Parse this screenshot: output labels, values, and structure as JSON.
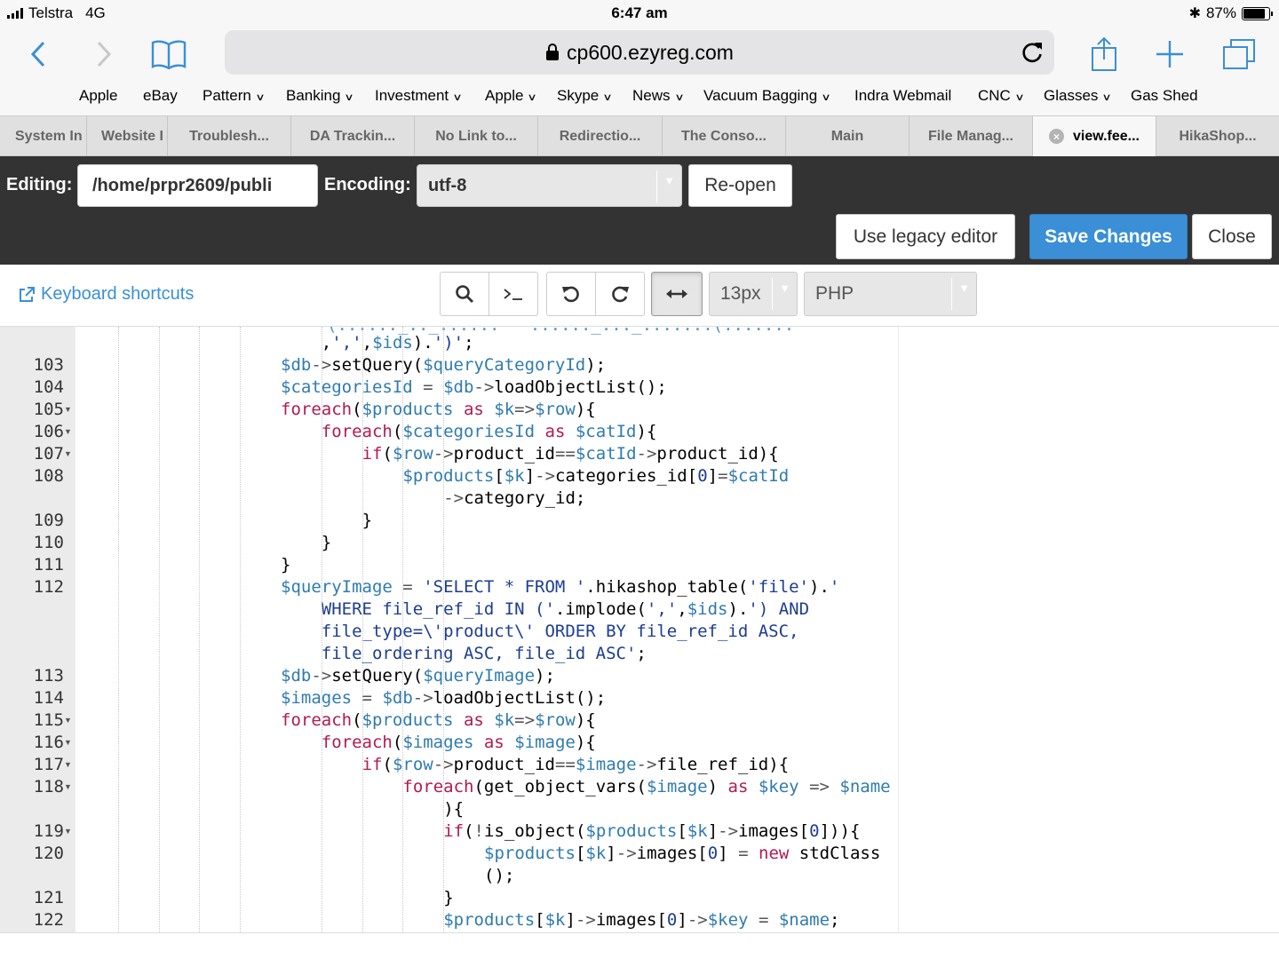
{
  "status_bar": {
    "carrier": "Telstra",
    "network": "4G",
    "time": "6:47 am",
    "battery": "87%",
    "battery_level": 0.87
  },
  "browser": {
    "url": "cp600.ezyreg.com",
    "icons": [
      "back-icon",
      "forward-icon",
      "bookmarks-book-icon",
      "lock-icon",
      "reload-icon",
      "share-icon",
      "new-tab-plus-icon",
      "tabs-overview-icon"
    ],
    "bookmarks": [
      {
        "label": "Apple",
        "dropdown": false
      },
      {
        "label": "eBay",
        "dropdown": false
      },
      {
        "label": "Pattern",
        "dropdown": true
      },
      {
        "label": "Banking",
        "dropdown": true
      },
      {
        "label": "Investment",
        "dropdown": true
      },
      {
        "label": "Apple",
        "dropdown": true
      },
      {
        "label": "Skype",
        "dropdown": true
      },
      {
        "label": "News",
        "dropdown": true
      },
      {
        "label": "Vacuum Bagging",
        "dropdown": true
      },
      {
        "label": "Indra Webmail",
        "dropdown": false
      },
      {
        "label": "CNC",
        "dropdown": true
      },
      {
        "label": "Glasses",
        "dropdown": true
      },
      {
        "label": "Gas Shed",
        "dropdown": false
      }
    ],
    "tabs": [
      "System In",
      "Website I",
      "Troublesh...",
      "DA Trackin...",
      "No Link to...",
      "Redirectio...",
      "The Conso...",
      "Main",
      "File Manag...",
      "view.fee...",
      "HikaShop..."
    ],
    "active_tab": 9
  },
  "editor_header": {
    "editing_label": "Editing:",
    "path": "/home/prpr2609/publi",
    "encoding_label": "Encoding:",
    "encoding": "utf-8",
    "reopen": "Re-open",
    "legacy": "Use legacy editor",
    "save": "Save Changes",
    "close": "Close"
  },
  "toolbar": {
    "keyboard_shortcuts": "Keyboard shortcuts",
    "font_size": "13px",
    "mode": "PHP",
    "buttons": [
      "search-icon",
      "terminal-icon",
      "undo-icon",
      "redo-icon",
      "wrap-icon"
    ]
  },
  "code": {
    "line_numbers": [
      "",
      "103",
      "104",
      "105",
      "106",
      "107",
      "108",
      "",
      "109",
      "110",
      "111",
      "112",
      "",
      "",
      "",
      "113",
      "114",
      "115",
      "116",
      "117",
      "118",
      "",
      "119",
      "120",
      "",
      "121",
      "122"
    ],
    "folds": [
      "105",
      "106",
      "107",
      "115",
      "116",
      "117",
      "118",
      "119"
    ],
    "lines": [
      {
        "indent": 6,
        "text": ",',',$ids).')';"
      },
      {
        "indent": 5,
        "text": "$db->setQuery($queryCategoryId);"
      },
      {
        "indent": 5,
        "text": "$categoriesId = $db->loadObjectList();"
      },
      {
        "indent": 5,
        "text": "foreach($products as $k=>$row){"
      },
      {
        "indent": 6,
        "text": "foreach($categoriesId as $catId){"
      },
      {
        "indent": 7,
        "text": "if($row->product_id==$catId->product_id){"
      },
      {
        "indent": 8,
        "text": "$products[$k]->categories_id[0]=$catId"
      },
      {
        "indent": 9,
        "text": "->category_id;"
      },
      {
        "indent": 7,
        "text": "}"
      },
      {
        "indent": 6,
        "text": "}"
      },
      {
        "indent": 5,
        "text": "}"
      },
      {
        "indent": 5,
        "text": "$queryImage = 'SELECT * FROM '.hikashop_table('file').'"
      },
      {
        "indent": 6,
        "text": "WHERE file_ref_id IN ('.implode(',',$ids).') AND"
      },
      {
        "indent": 6,
        "text": "file_type=\\'product\\' ORDER BY file_ref_id ASC,"
      },
      {
        "indent": 6,
        "text": "file_ordering ASC, file_id ASC';"
      },
      {
        "indent": 5,
        "text": "$db->setQuery($queryImage);"
      },
      {
        "indent": 5,
        "text": "$images = $db->loadObjectList();"
      },
      {
        "indent": 5,
        "text": "foreach($products as $k=>$row){"
      },
      {
        "indent": 6,
        "text": "foreach($images as $image){"
      },
      {
        "indent": 7,
        "text": "if($row->product_id==$image->file_ref_id){"
      },
      {
        "indent": 8,
        "text": "foreach(get_object_vars($image) as $key => $name"
      },
      {
        "indent": 9,
        "text": "){"
      },
      {
        "indent": 9,
        "text": "if(!is_object($products[$k]->images[0])){"
      },
      {
        "indent": 10,
        "text": "$products[$k]->images[0] = new stdClass"
      },
      {
        "indent": 10,
        "text": "();"
      },
      {
        "indent": 9,
        "text": "}"
      },
      {
        "indent": 9,
        "text": "$products[$k]->images[0]->$key = $name;"
      }
    ]
  },
  "colors": {
    "accent": "#3a8fd6",
    "dark_bar": "#333333",
    "keyword": "#b11b4d",
    "variable": "#2f7bb0",
    "string": "#1d3d92"
  }
}
